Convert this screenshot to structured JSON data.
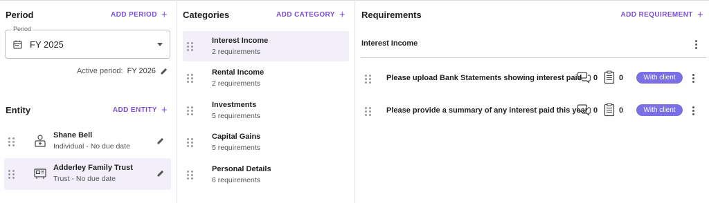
{
  "period": {
    "title": "Period",
    "add_label": "ADD PERIOD",
    "field_label": "Period",
    "selected": "FY 2025",
    "active_label": "Active period:",
    "active_value": "FY 2026"
  },
  "entity": {
    "title": "Entity",
    "add_label": "ADD ENTITY",
    "items": [
      {
        "name": "Shane Bell",
        "subtitle": "Individual - No due date",
        "icon": "person-icon",
        "selected": false
      },
      {
        "name": "Adderley Family Trust",
        "subtitle": "Trust - No due date",
        "icon": "trust-icon",
        "selected": true
      }
    ]
  },
  "categories": {
    "title": "Categories",
    "add_label": "ADD CATEGORY",
    "items": [
      {
        "name": "Interest Income",
        "subtitle": "2 requirements",
        "selected": true
      },
      {
        "name": "Rental Income",
        "subtitle": "2 requirements",
        "selected": false
      },
      {
        "name": "Investments",
        "subtitle": "5 requirements",
        "selected": false
      },
      {
        "name": "Capital Gains",
        "subtitle": "5 requirements",
        "selected": false
      },
      {
        "name": "Personal Details",
        "subtitle": "6 requirements",
        "selected": false
      }
    ]
  },
  "requirements": {
    "title": "Requirements",
    "add_label": "ADD REQUIREMENT",
    "category_title": "Interest Income",
    "items": [
      {
        "text": "Please upload Bank Statements showing interest paid",
        "comments": "0",
        "documents": "0",
        "status": "With client"
      },
      {
        "text": "Please provide a summary of any interest paid this year",
        "comments": "0",
        "documents": "0",
        "status": "With client"
      }
    ]
  },
  "colors": {
    "accent": "#7b4ce0",
    "status_pill": "#7a6fe4",
    "selected_bg": "#f2effb"
  }
}
